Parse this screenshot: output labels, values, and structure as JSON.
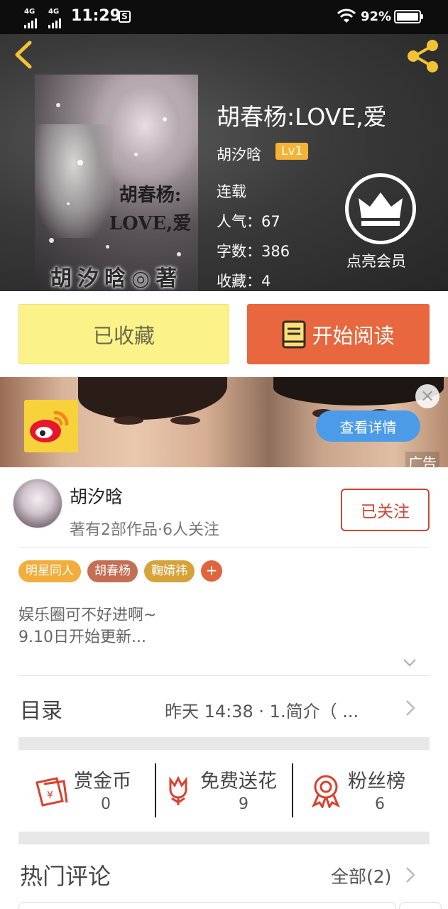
{
  "status_bar": {
    "net1": "4G",
    "net2": "4G",
    "time": "11:29",
    "battery_pct": "92%"
  },
  "header": {
    "book_title": "胡春杨:LOVE,爱",
    "author": "胡汐晗",
    "level": "Lv1",
    "status": "连载",
    "popularity": "人气：67",
    "word_count": "字数：386",
    "collections": "收藏：4",
    "vip_label": "点亮会员",
    "cover_title_line1": "胡春杨:",
    "cover_title_line2": "LOVE,爱",
    "cover_author": "胡汐晗◎著"
  },
  "actions": {
    "collected_label": "已收藏",
    "read_label": "开始阅读"
  },
  "ad": {
    "detail_label": "查看详情",
    "ad_tag": "广告",
    "close_symbol": "×"
  },
  "author_card": {
    "name": "胡汐晗",
    "stats": "著有2部作品·6人关注",
    "follow_label": "已关注",
    "tags": [
      {
        "label": "明星同人",
        "color": "#f2ad3b"
      },
      {
        "label": "胡春杨",
        "color": "#c46e52"
      },
      {
        "label": "鞠婧祎",
        "color": "#d6a23a"
      }
    ],
    "tag_plus": "+",
    "intro_line1": "娱乐圈可不好进啊~",
    "intro_line2": "9.10日开始更新..."
  },
  "toc": {
    "label": "目录",
    "latest": "昨天 14:38 · 1.简介（ ..."
  },
  "stats": [
    {
      "label": "赏金币",
      "value": "0"
    },
    {
      "label": "免费送花",
      "value": "9"
    },
    {
      "label": "粉丝榜",
      "value": "6"
    }
  ],
  "comments": {
    "label": "热门评论",
    "all_label": "全部(2)"
  },
  "colors": {
    "accent_orange": "#e8673e",
    "collected_yellow": "#fbf38a",
    "follow_red": "#cf4636",
    "icon_red": "#d8422f"
  }
}
